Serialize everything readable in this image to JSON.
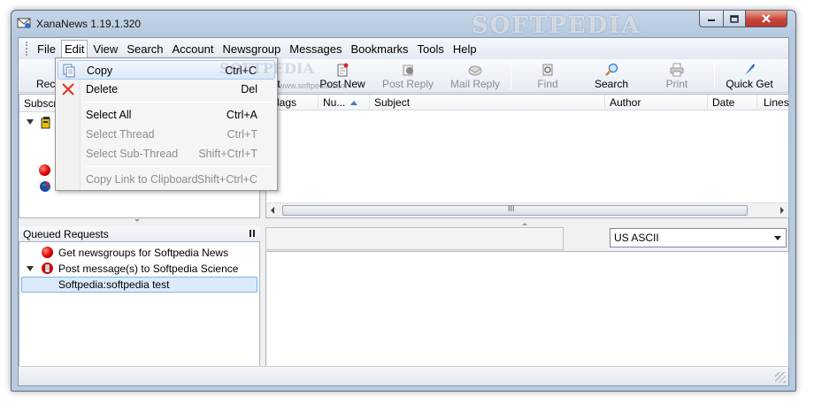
{
  "window": {
    "title": "XanaNews 1.19.1.320",
    "watermark": "SOFTPEDIA",
    "watermark_url": "www.softpedia.com"
  },
  "menubar": {
    "items": [
      "File",
      "Edit",
      "View",
      "Search",
      "Account",
      "Newsgroup",
      "Messages",
      "Bookmarks",
      "Tools",
      "Help"
    ]
  },
  "toolbar": {
    "reconnect_label": "Reco",
    "get_label": "t",
    "post_new_label": "Post New",
    "post_reply_label": "Post Reply",
    "mail_reply_label": "Mail Reply",
    "find_label": "Find",
    "search_label": "Search",
    "print_label": "Print",
    "quick_get_label": "Quick Get"
  },
  "left_pane": {
    "header": "Subscrib"
  },
  "message_list": {
    "columns": [
      "lags",
      "Nu...",
      "Subject",
      "Author",
      "Date",
      "Lines"
    ],
    "scroll_grip": "III"
  },
  "queued": {
    "header": "Queued Requests",
    "items": [
      "Get newsgroups for Softpedia News",
      "Post message(s) to Softpedia Science",
      "Softpedia:softpedia test"
    ]
  },
  "charset": {
    "selected": "US ASCII"
  },
  "edit_menu": {
    "items": [
      {
        "label": "Copy",
        "shortcut": "Ctrl+C"
      },
      {
        "label": "Delete",
        "shortcut": "Del"
      },
      {
        "label": "Select All",
        "shortcut": "Ctrl+A"
      },
      {
        "label": "Select Thread",
        "shortcut": "Ctrl+T"
      },
      {
        "label": "Select Sub-Thread",
        "shortcut": "Shift+Ctrl+T"
      },
      {
        "label": "Copy Link to Clipboard",
        "shortcut": "Shift+Ctrl+C"
      }
    ]
  },
  "colors": {
    "titlebar": "#c6d6e8",
    "selection": "#dcebfc",
    "close_button": "#c9463a"
  }
}
